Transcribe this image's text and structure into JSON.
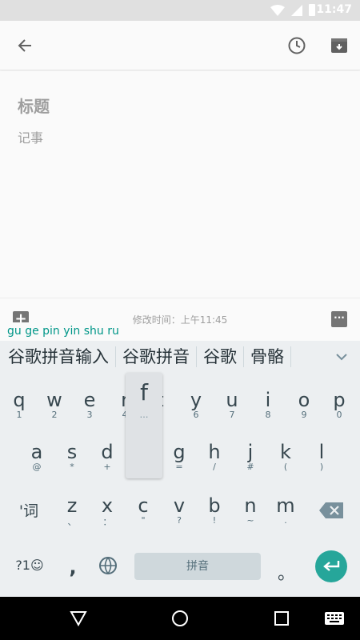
{
  "status_bar": {
    "time": "11:47"
  },
  "note": {
    "title_placeholder": "标题",
    "body_placeholder": "记事",
    "edit_time": "修改时间：上午11:45"
  },
  "ime": {
    "composing": "gu ge pin yin shu ru",
    "candidates": [
      "谷歌拼音输入",
      "谷歌拼音",
      "谷歌",
      "骨骼"
    ],
    "row1": [
      {
        "main": "q",
        "sub": "1"
      },
      {
        "main": "w",
        "sub": "2"
      },
      {
        "main": "e",
        "sub": "3"
      },
      {
        "main": "r",
        "sub": "4"
      },
      {
        "main": "f",
        "sub": "…"
      },
      {
        "main": "t",
        "sub": "5"
      },
      {
        "main": "y",
        "sub": "6"
      },
      {
        "main": "u",
        "sub": "7"
      },
      {
        "main": "i",
        "sub": "8"
      },
      {
        "main": "o",
        "sub": "9"
      },
      {
        "main": "p",
        "sub": "0"
      }
    ],
    "row2": [
      {
        "main": "a",
        "sub": "@"
      },
      {
        "main": "s",
        "sub": "*"
      },
      {
        "main": "d",
        "sub": "+"
      },
      {
        "main": "g",
        "sub": "="
      },
      {
        "main": "h",
        "sub": "/"
      },
      {
        "main": "j",
        "sub": "#"
      },
      {
        "main": "k",
        "sub": "("
      },
      {
        "main": "l",
        "sub": ")"
      }
    ],
    "row3": [
      {
        "main": "z",
        "sub": "、"
      },
      {
        "main": "x",
        "sub": "："
      },
      {
        "main": "c",
        "sub": "\""
      },
      {
        "main": "v",
        "sub": "?"
      },
      {
        "main": "b",
        "sub": "!"
      },
      {
        "main": "n",
        "sub": "~"
      },
      {
        "main": "m",
        "sub": "."
      }
    ],
    "shift_label": "'词",
    "symbols_label": "?1☺",
    "comma_label": ",",
    "space_label": "拼音",
    "period_label": "。",
    "popup": {
      "main": "f",
      "sub": "…"
    }
  },
  "colors": {
    "accent": "#26a69a",
    "composing": "#009688"
  }
}
